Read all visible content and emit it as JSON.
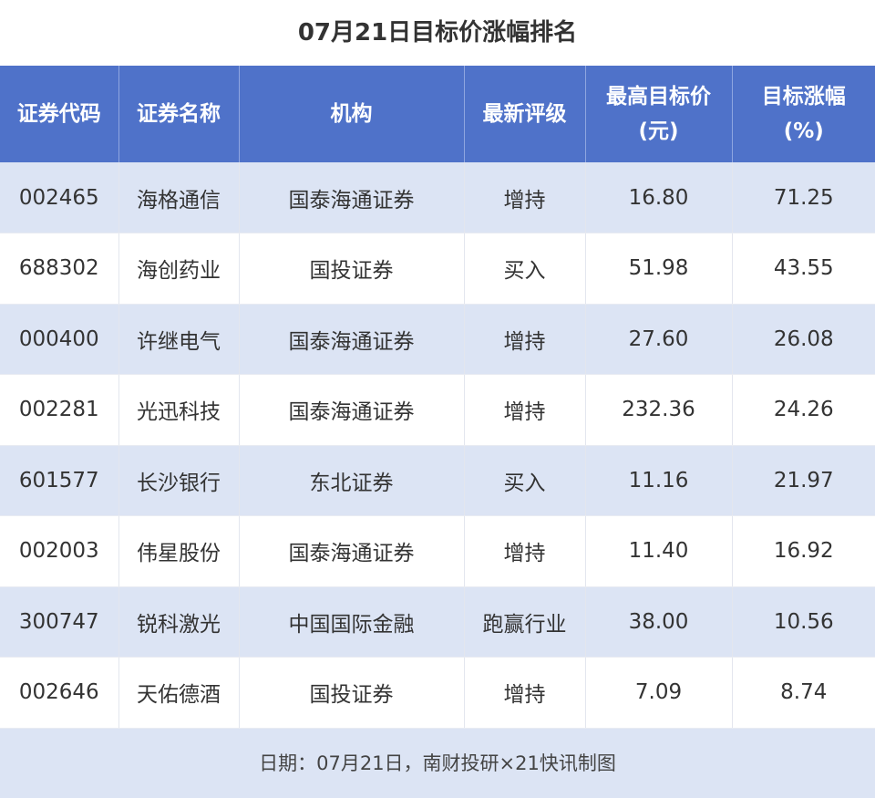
{
  "chart_data": {
    "type": "table",
    "title": "07月21日目标价涨幅排名",
    "columns": [
      {
        "line1": "证券代码",
        "line2": ""
      },
      {
        "line1": "证券名称",
        "line2": ""
      },
      {
        "line1": "机构",
        "line2": ""
      },
      {
        "line1": "最新评级",
        "line2": ""
      },
      {
        "line1": "最高目标价",
        "line2": "(元)"
      },
      {
        "line1": "目标涨幅",
        "line2": "(%)"
      }
    ],
    "rows": [
      [
        "002465",
        "海格通信",
        "国泰海通证券",
        "增持",
        "16.80",
        "71.25"
      ],
      [
        "688302",
        "海创药业",
        "国投证券",
        "买入",
        "51.98",
        "43.55"
      ],
      [
        "000400",
        "许继电气",
        "国泰海通证券",
        "增持",
        "27.60",
        "26.08"
      ],
      [
        "002281",
        "光迅科技",
        "国泰海通证券",
        "增持",
        "232.36",
        "24.26"
      ],
      [
        "601577",
        "长沙银行",
        "东北证券",
        "买入",
        "11.16",
        "21.97"
      ],
      [
        "002003",
        "伟星股份",
        "国泰海通证券",
        "增持",
        "11.40",
        "16.92"
      ],
      [
        "300747",
        "锐科激光",
        "中国国际金融",
        "跑赢行业",
        "38.00",
        "10.56"
      ],
      [
        "002646",
        "天佑德酒",
        "国投证券",
        "增持",
        "7.09",
        "8.74"
      ]
    ],
    "footer": "日期：07月21日，南财投研×21快讯制图"
  },
  "colors": {
    "header_bg": "#4f72c9",
    "stripe_bg": "#dce4f4",
    "text": "#333333"
  }
}
